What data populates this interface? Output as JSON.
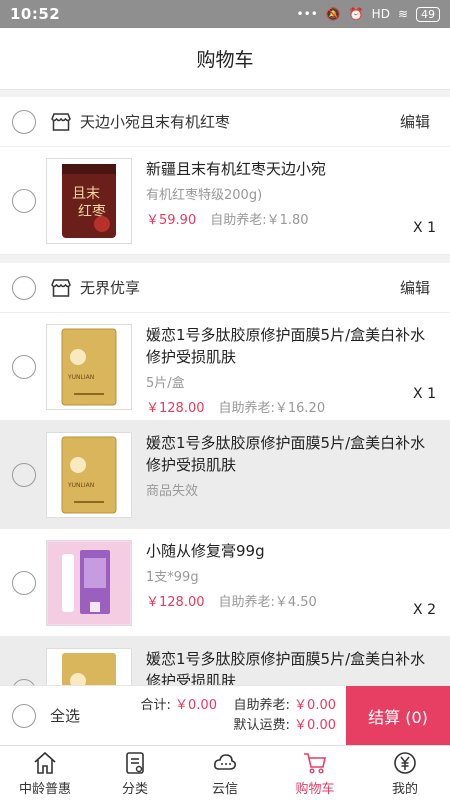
{
  "status": {
    "time": "10:52",
    "network": "HD",
    "battery": "49"
  },
  "nav": {
    "title": "购物车"
  },
  "stores": [
    {
      "name": "天边小宛且末有机红枣",
      "edit": "编辑",
      "items": [
        {
          "name": "新疆且末有机红枣天边小宛",
          "spec": "有机红枣特级200g)",
          "price": "￥59.90",
          "pension": "自助养老:￥1.80",
          "qty": "X 1",
          "image": "jujube-package"
        }
      ]
    },
    {
      "name": "无界优享",
      "edit": "编辑",
      "items": [
        {
          "name": "媛恋1号多肽胶原修护面膜5片/盒美白补水修护受损肌肤",
          "spec": "5片/盒",
          "price": "￥128.00",
          "pension": "自助养老:￥16.20",
          "qty": "X 1",
          "image": "gold-mask-box"
        },
        {
          "name": "媛恋1号多肽胶原修护面膜5片/盒美白补水修护受损肌肤",
          "spec": "商品失效",
          "price": "",
          "pension": "",
          "qty": "",
          "image": "gold-mask-box"
        },
        {
          "name": "小随从修复膏99g",
          "spec": "1支*99g",
          "price": "￥128.00",
          "pension": "自助养老:￥4.50",
          "qty": "X 2",
          "image": "cream-tube"
        },
        {
          "name": "媛恋1号多肽胶原修护面膜5片/盒美白补水修护受损肌肤",
          "spec": "",
          "price": "",
          "pension": "",
          "qty": "",
          "image": "gold-mask-box"
        }
      ]
    }
  ],
  "checkout": {
    "select_all": "全选",
    "total_label": "合计:",
    "total_value": "￥0.00",
    "pension_label": "自助养老:",
    "pension_value": "￥0.00",
    "shipping_label": "默认运费:",
    "shipping_value": "￥0.00",
    "settle": "结算 (0)"
  },
  "tabs": [
    {
      "label": "中龄普惠",
      "icon": "home-icon"
    },
    {
      "label": "分类",
      "icon": "category-icon"
    },
    {
      "label": "云信",
      "icon": "cloud-message-icon"
    },
    {
      "label": "购物车",
      "icon": "cart-icon",
      "active": true
    },
    {
      "label": "我的",
      "icon": "yen-icon"
    }
  ],
  "colors": {
    "accent": "#e63f63",
    "price": "#e83a5f",
    "statusbar": "#8f8f8f"
  }
}
